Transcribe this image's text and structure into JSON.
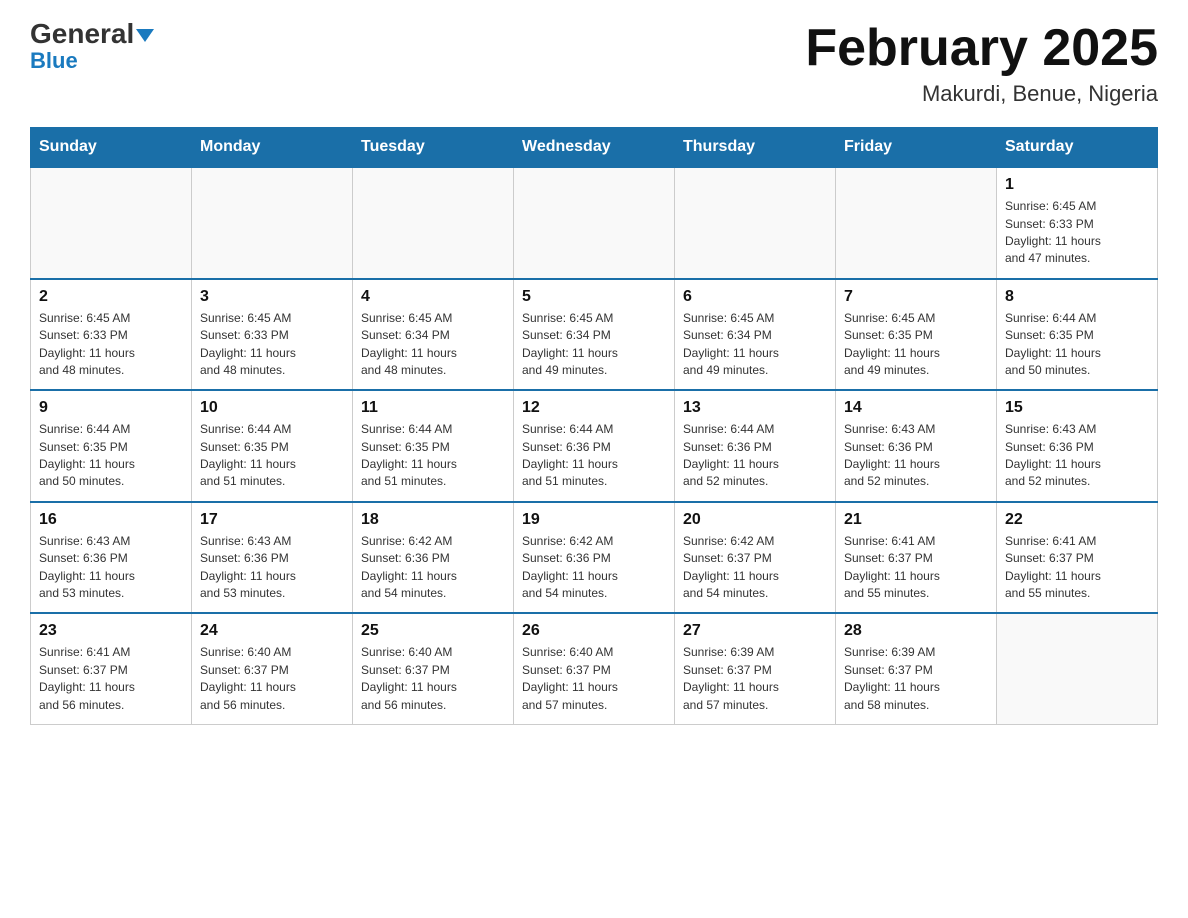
{
  "header": {
    "logo_general": "General",
    "logo_blue": "Blue",
    "title": "February 2025",
    "subtitle": "Makurdi, Benue, Nigeria"
  },
  "days_of_week": [
    "Sunday",
    "Monday",
    "Tuesday",
    "Wednesday",
    "Thursday",
    "Friday",
    "Saturday"
  ],
  "weeks": [
    [
      {
        "day": "",
        "info": ""
      },
      {
        "day": "",
        "info": ""
      },
      {
        "day": "",
        "info": ""
      },
      {
        "day": "",
        "info": ""
      },
      {
        "day": "",
        "info": ""
      },
      {
        "day": "",
        "info": ""
      },
      {
        "day": "1",
        "info": "Sunrise: 6:45 AM\nSunset: 6:33 PM\nDaylight: 11 hours\nand 47 minutes."
      }
    ],
    [
      {
        "day": "2",
        "info": "Sunrise: 6:45 AM\nSunset: 6:33 PM\nDaylight: 11 hours\nand 48 minutes."
      },
      {
        "day": "3",
        "info": "Sunrise: 6:45 AM\nSunset: 6:33 PM\nDaylight: 11 hours\nand 48 minutes."
      },
      {
        "day": "4",
        "info": "Sunrise: 6:45 AM\nSunset: 6:34 PM\nDaylight: 11 hours\nand 48 minutes."
      },
      {
        "day": "5",
        "info": "Sunrise: 6:45 AM\nSunset: 6:34 PM\nDaylight: 11 hours\nand 49 minutes."
      },
      {
        "day": "6",
        "info": "Sunrise: 6:45 AM\nSunset: 6:34 PM\nDaylight: 11 hours\nand 49 minutes."
      },
      {
        "day": "7",
        "info": "Sunrise: 6:45 AM\nSunset: 6:35 PM\nDaylight: 11 hours\nand 49 minutes."
      },
      {
        "day": "8",
        "info": "Sunrise: 6:44 AM\nSunset: 6:35 PM\nDaylight: 11 hours\nand 50 minutes."
      }
    ],
    [
      {
        "day": "9",
        "info": "Sunrise: 6:44 AM\nSunset: 6:35 PM\nDaylight: 11 hours\nand 50 minutes."
      },
      {
        "day": "10",
        "info": "Sunrise: 6:44 AM\nSunset: 6:35 PM\nDaylight: 11 hours\nand 51 minutes."
      },
      {
        "day": "11",
        "info": "Sunrise: 6:44 AM\nSunset: 6:35 PM\nDaylight: 11 hours\nand 51 minutes."
      },
      {
        "day": "12",
        "info": "Sunrise: 6:44 AM\nSunset: 6:36 PM\nDaylight: 11 hours\nand 51 minutes."
      },
      {
        "day": "13",
        "info": "Sunrise: 6:44 AM\nSunset: 6:36 PM\nDaylight: 11 hours\nand 52 minutes."
      },
      {
        "day": "14",
        "info": "Sunrise: 6:43 AM\nSunset: 6:36 PM\nDaylight: 11 hours\nand 52 minutes."
      },
      {
        "day": "15",
        "info": "Sunrise: 6:43 AM\nSunset: 6:36 PM\nDaylight: 11 hours\nand 52 minutes."
      }
    ],
    [
      {
        "day": "16",
        "info": "Sunrise: 6:43 AM\nSunset: 6:36 PM\nDaylight: 11 hours\nand 53 minutes."
      },
      {
        "day": "17",
        "info": "Sunrise: 6:43 AM\nSunset: 6:36 PM\nDaylight: 11 hours\nand 53 minutes."
      },
      {
        "day": "18",
        "info": "Sunrise: 6:42 AM\nSunset: 6:36 PM\nDaylight: 11 hours\nand 54 minutes."
      },
      {
        "day": "19",
        "info": "Sunrise: 6:42 AM\nSunset: 6:36 PM\nDaylight: 11 hours\nand 54 minutes."
      },
      {
        "day": "20",
        "info": "Sunrise: 6:42 AM\nSunset: 6:37 PM\nDaylight: 11 hours\nand 54 minutes."
      },
      {
        "day": "21",
        "info": "Sunrise: 6:41 AM\nSunset: 6:37 PM\nDaylight: 11 hours\nand 55 minutes."
      },
      {
        "day": "22",
        "info": "Sunrise: 6:41 AM\nSunset: 6:37 PM\nDaylight: 11 hours\nand 55 minutes."
      }
    ],
    [
      {
        "day": "23",
        "info": "Sunrise: 6:41 AM\nSunset: 6:37 PM\nDaylight: 11 hours\nand 56 minutes."
      },
      {
        "day": "24",
        "info": "Sunrise: 6:40 AM\nSunset: 6:37 PM\nDaylight: 11 hours\nand 56 minutes."
      },
      {
        "day": "25",
        "info": "Sunrise: 6:40 AM\nSunset: 6:37 PM\nDaylight: 11 hours\nand 56 minutes."
      },
      {
        "day": "26",
        "info": "Sunrise: 6:40 AM\nSunset: 6:37 PM\nDaylight: 11 hours\nand 57 minutes."
      },
      {
        "day": "27",
        "info": "Sunrise: 6:39 AM\nSunset: 6:37 PM\nDaylight: 11 hours\nand 57 minutes."
      },
      {
        "day": "28",
        "info": "Sunrise: 6:39 AM\nSunset: 6:37 PM\nDaylight: 11 hours\nand 58 minutes."
      },
      {
        "day": "",
        "info": ""
      }
    ]
  ]
}
